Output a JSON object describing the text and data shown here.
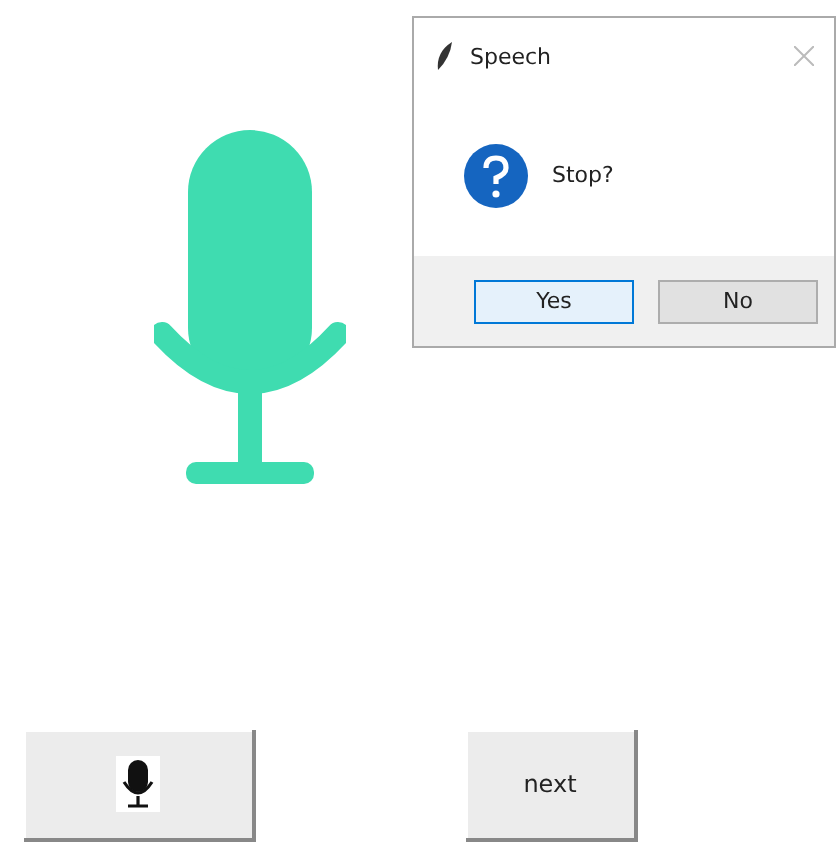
{
  "dialog": {
    "title": "Speech",
    "message": "Stop?",
    "buttons": [
      {
        "label": "Yes",
        "default": true
      },
      {
        "label": "No",
        "default": false
      }
    ]
  },
  "buttons": [
    {
      "kind": "icon"
    },
    {
      "kind": "text",
      "label": "next"
    }
  ]
}
